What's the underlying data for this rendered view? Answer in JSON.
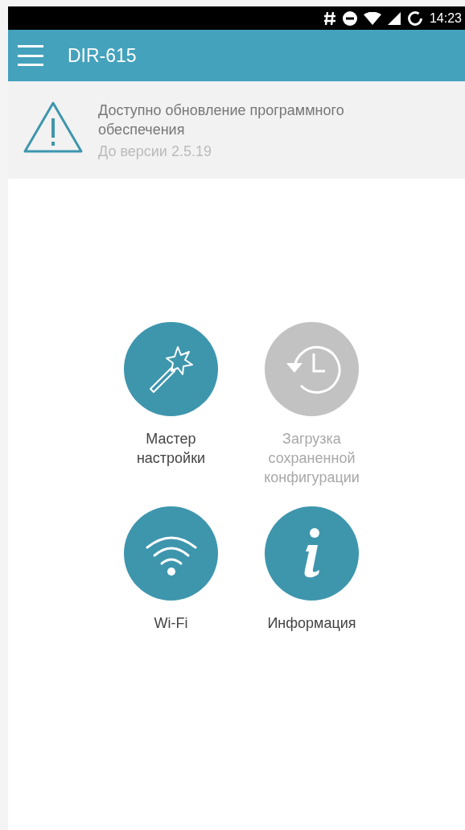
{
  "status_bar": {
    "time": "14:23"
  },
  "app_bar": {
    "title": "DIR-615"
  },
  "notice": {
    "title": "Доступно обновление программного обеспечения",
    "subtitle": "До версии 2.5.19"
  },
  "tiles": [
    {
      "label": "Мастер настройки",
      "kind": "wand",
      "disabled": false
    },
    {
      "label": "Загрузка сохраненной конфигурации",
      "kind": "history",
      "disabled": true
    },
    {
      "label": "Wi-Fi",
      "kind": "wifi",
      "disabled": false
    },
    {
      "label": "Информация",
      "kind": "info",
      "disabled": false
    }
  ]
}
